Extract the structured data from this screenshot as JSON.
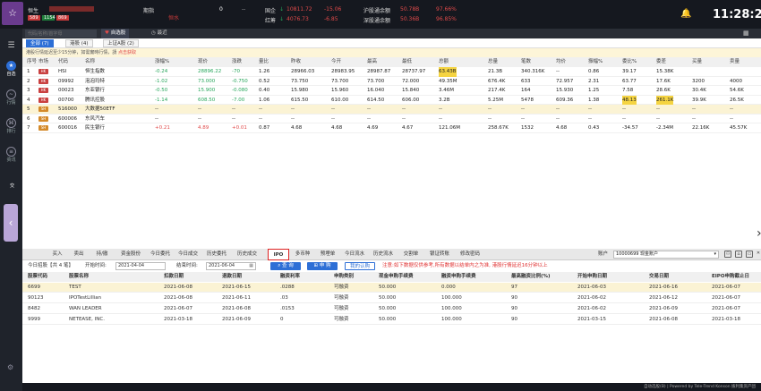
{
  "header": {
    "index_name": "恒生",
    "index_sub": [
      "589",
      "1154",
      "869"
    ],
    "col2_label": "期指",
    "col2_sub": "恒水",
    "col2_value": "0",
    "col2_change": "--",
    "gk_label": "国企",
    "gk_value": "10811.72",
    "gk_change": "-15.06",
    "hc_label": "红筹",
    "hc_value": "4076.73",
    "hc_change": "-6.85",
    "hgt_label": "沪股通余额",
    "hgt_value": "50.78B",
    "hgt_pct": "97.66%",
    "sgt_label": "深股通余额",
    "sgt_value": "50.36B",
    "sgt_pct": "96.85%",
    "time": "11:28:29"
  },
  "sidebar": {
    "items": [
      {
        "label": "自选",
        "icon": "star-icon"
      },
      {
        "label": "行情",
        "icon": "chart-icon"
      },
      {
        "label": "排行",
        "icon": "rank-icon"
      },
      {
        "label": "资讯",
        "icon": "news-icon"
      }
    ],
    "handle_label": "交"
  },
  "topbar": {
    "search_placeholder": "代码/名称/首字母",
    "tabs": [
      "自选股",
      "最近"
    ]
  },
  "quote": {
    "subtabs": [
      "全部 (7)",
      "港股 (4)",
      "上证A股 (2)"
    ],
    "notice": "港股行情延迟至少15分钟，如需實時行情，請",
    "notice_link": "点击获取",
    "columns": [
      "序号",
      "市场",
      "代码",
      "名称",
      "涨幅%",
      "现价",
      "涨跌",
      "量比",
      "昨收",
      "今开",
      "最高",
      "最低",
      "总额",
      "总量",
      "笔数",
      "均价",
      "振幅%",
      "委比%",
      "委差",
      "买量",
      "卖量"
    ],
    "rows": [
      {
        "no": "1",
        "mkt": "HK",
        "code": "HSI",
        "name": "恒生指数",
        "pct": "-0.24",
        "price": "28896.22",
        "chg": "-70",
        "lb": "1.26",
        "prev": "28966.03",
        "open": "28983.95",
        "high": "28987.87",
        "low": "28737.97",
        "amt": "63.43B",
        "vol": "21.3B",
        "cnt": "340.316K",
        "avg": "--",
        "amp": "0.86",
        "wb": "39.17",
        "wc": "15.38K",
        "buy": "",
        "sell": "",
        "cls": "dn",
        "hl": false
      },
      {
        "no": "2",
        "mkt": "HK",
        "code": "09992",
        "name": "泡泡玛特",
        "pct": "-1.02",
        "price": "73.000",
        "chg": "-0.750",
        "lb": "0.52",
        "prev": "73.750",
        "open": "73.700",
        "high": "73.700",
        "low": "72.000",
        "amt": "49.35M",
        "vol": "676.4K",
        "cnt": "633",
        "avg": "72.957",
        "amp": "2.31",
        "wb": "63.77",
        "wc": "17.6K",
        "buy": "3200",
        "sell": "4000",
        "cls": "dn",
        "hl": false
      },
      {
        "no": "3",
        "mkt": "HK",
        "code": "00023",
        "name": "东亚银行",
        "pct": "-0.50",
        "price": "15.900",
        "chg": "-0.080",
        "lb": "0.40",
        "prev": "15.980",
        "open": "15.960",
        "high": "16.040",
        "low": "15.840",
        "amt": "3.46M",
        "vol": "217.4K",
        "cnt": "164",
        "avg": "15.930",
        "amp": "1.25",
        "wb": "7.58",
        "wc": "28.6K",
        "buy": "30.4K",
        "sell": "54.6K",
        "cls": "dn",
        "hl": false
      },
      {
        "no": "4",
        "mkt": "HK",
        "code": "00700",
        "name": "腾讯控股",
        "pct": "-1.14",
        "price": "608.50",
        "chg": "-7.00",
        "lb": "1.06",
        "prev": "615.50",
        "open": "610.00",
        "high": "614.50",
        "low": "606.00",
        "amt": "3.2B",
        "vol": "5.25M",
        "cnt": "5478",
        "avg": "609.36",
        "amp": "1.38",
        "wb": "48.13",
        "wc": "261.1K",
        "buy": "39.9K",
        "sell": "26.5K",
        "cls": "dn",
        "hl": false
      },
      {
        "no": "5",
        "mkt": "SH",
        "code": "516000",
        "name": "大数据50ETF",
        "pct": "--",
        "price": "--",
        "chg": "--",
        "lb": "--",
        "prev": "--",
        "open": "--",
        "high": "--",
        "low": "--",
        "amt": "--",
        "vol": "--",
        "cnt": "--",
        "avg": "--",
        "amp": "--",
        "wb": "--",
        "wc": "--",
        "buy": "--",
        "sell": "--",
        "cls": "",
        "hl": true
      },
      {
        "no": "6",
        "mkt": "SH",
        "code": "600006",
        "name": "东风汽车",
        "pct": "--",
        "price": "--",
        "chg": "--",
        "lb": "--",
        "prev": "--",
        "open": "--",
        "high": "--",
        "low": "--",
        "amt": "--",
        "vol": "--",
        "cnt": "--",
        "avg": "--",
        "amp": "--",
        "wb": "--",
        "wc": "--",
        "buy": "--",
        "sell": "--",
        "cls": "",
        "hl": false
      },
      {
        "no": "7",
        "mkt": "SH",
        "code": "600016",
        "name": "民生银行",
        "pct": "+0.21",
        "price": "4.89",
        "chg": "+0.01",
        "lb": "0.87",
        "prev": "4.68",
        "open": "4.68",
        "high": "4.69",
        "low": "4.67",
        "amt": "121.06M",
        "vol": "258.67K",
        "cnt": "1532",
        "avg": "4.68",
        "amp": "0.43",
        "wb": "-34.57",
        "wc": "-2.34M",
        "buy": "22.16K",
        "sell": "45.57K",
        "cls": "up",
        "hl": false
      }
    ]
  },
  "trade": {
    "tabs": [
      "买入",
      "卖出",
      "持/撤",
      "资金股份",
      "今日委托",
      "今日成交",
      "历史委托",
      "历史成交",
      "IPO",
      "多币种",
      "预埋单",
      "今日流水",
      "历史流水",
      "交割单",
      "银证转账",
      "修改密码"
    ],
    "account_label": "账户",
    "account_value": "10000699 现金账户",
    "filter": {
      "today_label": "今日招股【共 4 笔】",
      "start_label": "开始时间:",
      "start_value": "2021-04-04",
      "end_label": "结束时间:",
      "end_value": "2021-06-04",
      "query_btn": "查 询",
      "apply_btn": "申 购",
      "my_btn": "我的认购",
      "warning": "注意:如下数据仅供参考,所有数据以结单内之为准, 港股行情延迟16分钟以上"
    },
    "columns": [
      "股票代码",
      "股票名称",
      "扣款日期",
      "退款日期",
      "融资利率",
      "申购类别",
      "现金申购手续费",
      "融资申购手续费",
      "最高融资比例(%)",
      "开始申购日期",
      "交易日期",
      "EIPO申购截止日"
    ],
    "rows": [
      {
        "code": "6699",
        "name": "TEST",
        "deduct": "2021-06-08",
        "refund": "2021-06-15",
        "rate": ".0288",
        "type": "可融资",
        "cash_fee": "50.000",
        "fin_fee": "0.000",
        "max_pct": "97",
        "start": "2021-06-03",
        "trade_date": "2021-06-16",
        "eipo_end": "2021-06-07",
        "sel": true
      },
      {
        "code": "90123",
        "name": "IPOTestLillian",
        "deduct": "2021-06-08",
        "refund": "2021-06-11",
        "rate": ".03",
        "type": "可融资",
        "cash_fee": "50.000",
        "fin_fee": "100.000",
        "max_pct": "90",
        "start": "2021-06-02",
        "trade_date": "2021-06-12",
        "eipo_end": "2021-06-07",
        "sel": false
      },
      {
        "code": "8482",
        "name": "WAN LEADER",
        "deduct": "2021-06-07",
        "refund": "2021-06-08",
        "rate": ".0153",
        "type": "可融资",
        "cash_fee": "50.000",
        "fin_fee": "100.000",
        "max_pct": "90",
        "start": "2021-06-02",
        "trade_date": "2021-06-09",
        "eipo_end": "2021-06-07",
        "sel": false
      },
      {
        "code": "9999",
        "name": "NETEASE, INC.",
        "deduct": "2021-03-18",
        "refund": "2021-06-09",
        "rate": "0",
        "type": "可融资",
        "cash_fee": "50.000",
        "fin_fee": "100.000",
        "max_pct": "90",
        "start": "2021-03-15",
        "trade_date": "2021-06-08",
        "eipo_end": "2021-03-18",
        "sel": false
      }
    ]
  },
  "footer": "自动选股(B) | Powered by Tele-Trend Konson  拨利集资产团",
  "colors": {
    "accent": "#2d6fd6",
    "up": "#e04a4a",
    "down": "#25a55a",
    "highlight": "#fbf3d4"
  }
}
